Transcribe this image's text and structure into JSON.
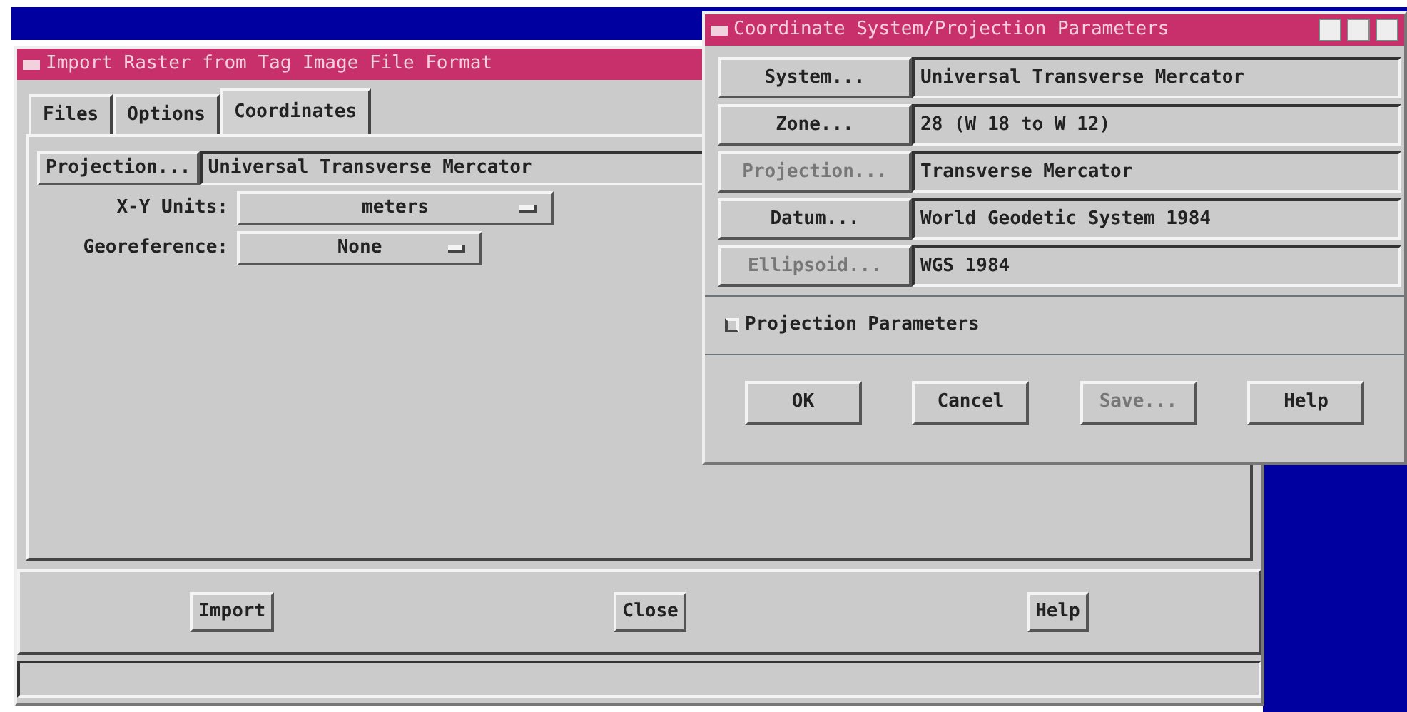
{
  "main_window": {
    "title": "Import Raster from Tag Image File Format",
    "tabs": [
      {
        "label": "Files",
        "selected": false
      },
      {
        "label": "Options",
        "selected": false
      },
      {
        "label": "Coordinates",
        "selected": true
      }
    ],
    "projection": {
      "button": "Projection...",
      "value": "Universal Transverse Mercator"
    },
    "xy_units": {
      "label": "X-Y Units:",
      "value": "meters"
    },
    "georeference": {
      "label": "Georeference:",
      "value": "None"
    },
    "buttons": [
      "Import",
      "Close",
      "Help"
    ]
  },
  "dialog": {
    "title": "Coordinate System/Projection Parameters",
    "rows": [
      {
        "button": "System...",
        "value": "Universal Transverse Mercator",
        "disabled": false
      },
      {
        "button": "Zone...",
        "value": "28 (W 18 to W 12)",
        "disabled": false
      },
      {
        "button": "Projection...",
        "value": "Transverse Mercator",
        "disabled": true
      },
      {
        "button": "Datum...",
        "value": "World Geodetic System 1984",
        "disabled": false
      },
      {
        "button": "Ellipsoid...",
        "value": "WGS 1984",
        "disabled": true
      }
    ],
    "checkbox": {
      "label": "Projection Parameters",
      "checked": false
    },
    "buttons": [
      {
        "label": "OK",
        "disabled": false
      },
      {
        "label": "Cancel",
        "disabled": false
      },
      {
        "label": "Save...",
        "disabled": true
      },
      {
        "label": "Help",
        "disabled": false
      }
    ]
  }
}
